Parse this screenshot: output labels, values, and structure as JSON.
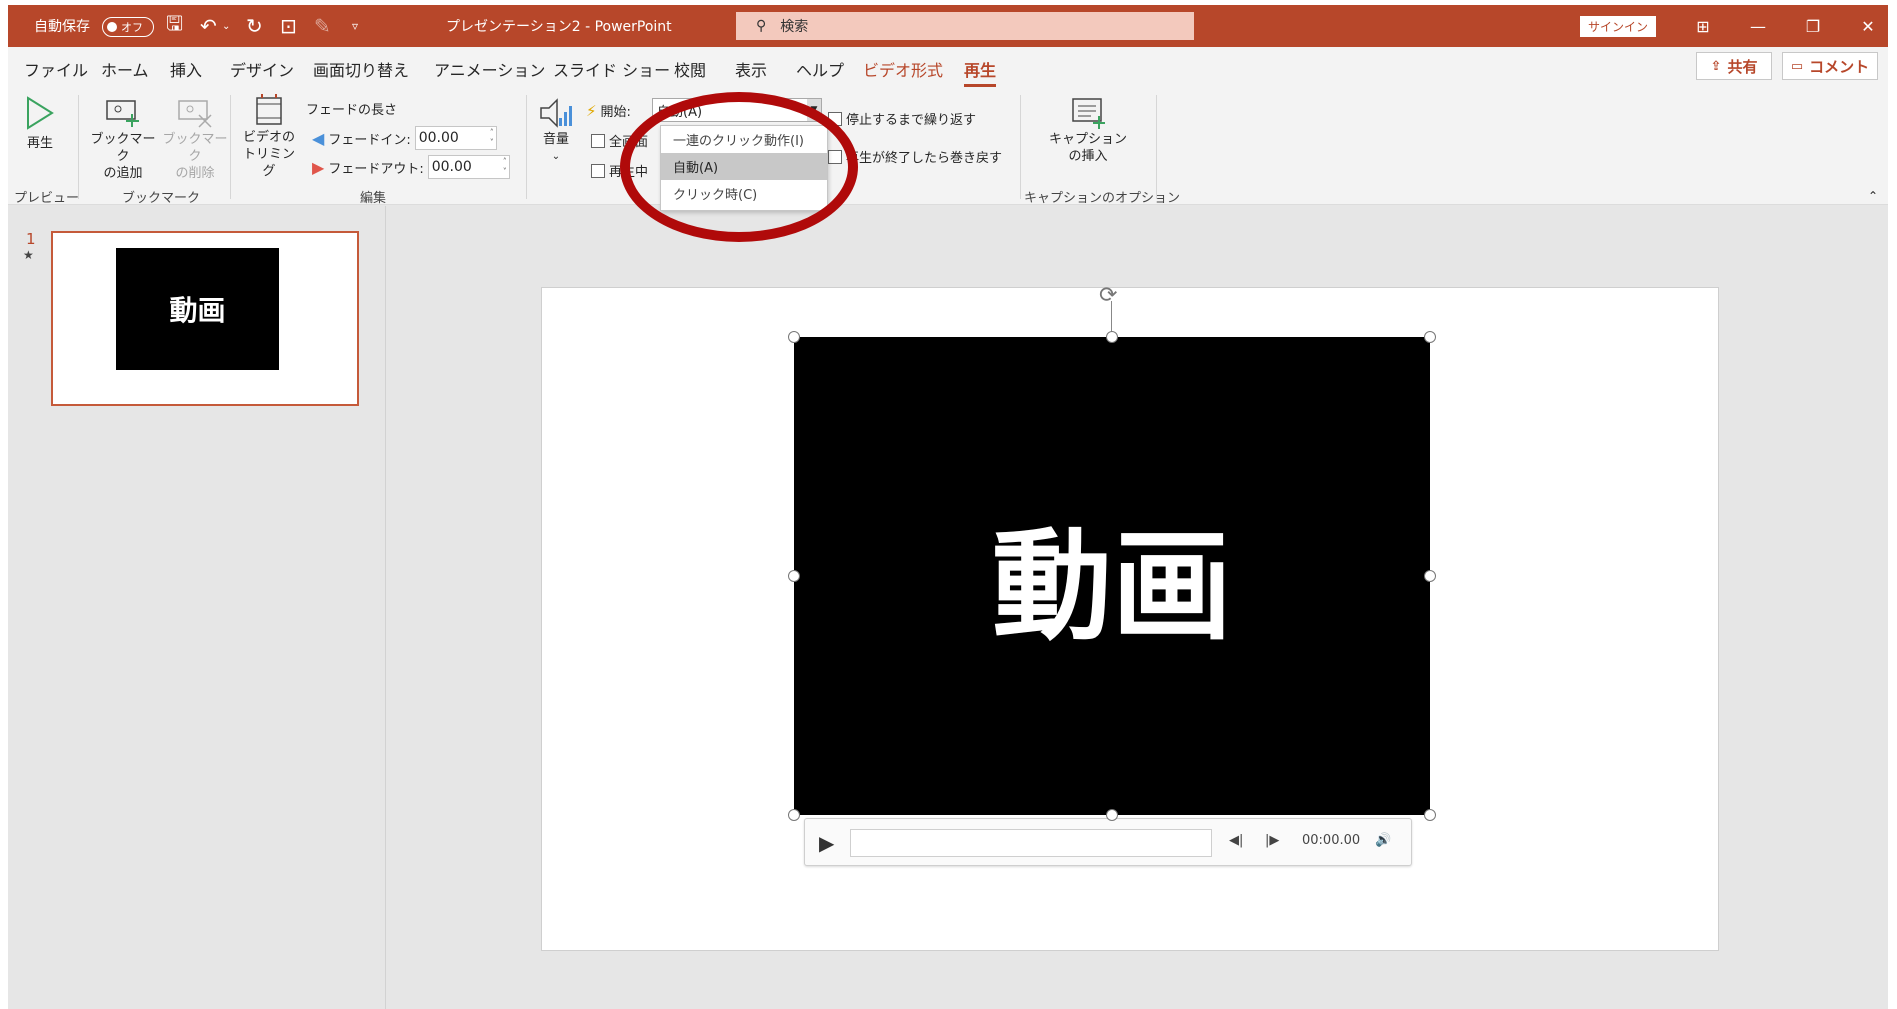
{
  "titlebar": {
    "autosave_label": "自動保存",
    "autosave_state": "オフ",
    "document_title": "プレゼンテーション2 - PowerPoint",
    "search_placeholder": "検索",
    "signin_label": "サインイン",
    "accent_color": "#b7472a"
  },
  "tabs": [
    {
      "label": "ファイル"
    },
    {
      "label": "ホーム"
    },
    {
      "label": "挿入"
    },
    {
      "label": "デザイン"
    },
    {
      "label": "画面切り替え"
    },
    {
      "label": "アニメーション"
    },
    {
      "label": "スライド ショー"
    },
    {
      "label": "校閲"
    },
    {
      "label": "表示"
    },
    {
      "label": "ヘルプ"
    },
    {
      "label": "ビデオ形式"
    },
    {
      "label": "再生"
    }
  ],
  "share_label": "共有",
  "comment_label": "コメント",
  "ribbon": {
    "preview": {
      "play_label": "再生",
      "group_label": "プレビュー"
    },
    "bookmark": {
      "add_label_1": "ブックマーク",
      "add_label_2": "の追加",
      "remove_label_1": "ブックマーク",
      "remove_label_2": "の削除",
      "group_label": "ブックマーク"
    },
    "edit": {
      "trim_label_1": "ビデオの",
      "trim_label_2": "トリミング",
      "fade_title": "フェードの長さ",
      "fade_in_label": "フェードイン:",
      "fade_in_value": "00.00",
      "fade_out_label": "フェードアウト:",
      "fade_out_value": "00.00",
      "group_label": "編集"
    },
    "video_options": {
      "volume_label": "音量",
      "start_label": "開始:",
      "start_value": "自動(A)",
      "fullscreen_label": "全画面",
      "hide_label": "再生中",
      "loop_label": "停止するまで繰り返す",
      "rewind_label": "再生が終了したら巻き戻す"
    },
    "caption": {
      "insert_label_1": "キャプション",
      "insert_label_2": "の挿入",
      "group_label": "キャプションのオプション"
    }
  },
  "start_dropdown": {
    "options": [
      {
        "label": "一連のクリック動作(I)",
        "selected": false
      },
      {
        "label": "自動(A)",
        "selected": true
      },
      {
        "label": "クリック時(C)",
        "selected": false
      }
    ]
  },
  "thumbnails": {
    "slide_number": "1",
    "transition_marker": "★",
    "thumb_text": "動画"
  },
  "slide": {
    "video_text": "動画",
    "time_display": "00:00.00"
  }
}
